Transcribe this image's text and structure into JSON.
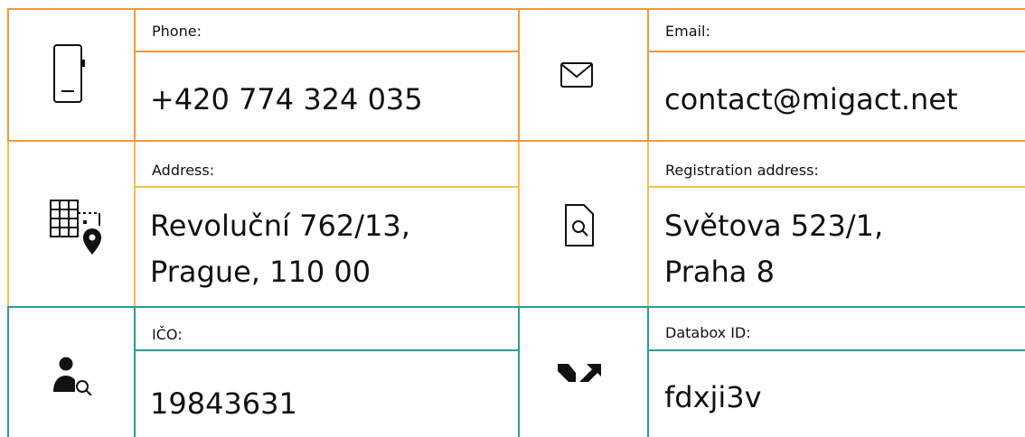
{
  "colors": {
    "row1_border": "#ef9a3d",
    "row2_border": "#f2c14e",
    "row3_border": "#2a9d97",
    "text": "#111111"
  },
  "cards": [
    {
      "id": "phone",
      "icon": "smartphone-icon",
      "label": "Phone:",
      "value_lines": [
        "+420 774 324 035"
      ]
    },
    {
      "id": "email",
      "icon": "envelope-icon",
      "label": "Email:",
      "value_lines": [
        "contact@migact.net"
      ]
    },
    {
      "id": "address",
      "icon": "building-pin-icon",
      "label": "Address:",
      "value_lines": [
        "Revoluční 762/13,",
        "Prague, 110 00"
      ]
    },
    {
      "id": "registration-address",
      "icon": "document-search-icon",
      "label": "Registration address:",
      "value_lines": [
        "Světova 523/1,",
        "Praha 8"
      ]
    },
    {
      "id": "ico",
      "icon": "person-search-icon",
      "label": "IČO:",
      "value_lines": [
        "19843631"
      ]
    },
    {
      "id": "databox",
      "icon": "databox-arrows-icon",
      "label": "Databox ID:",
      "value_lines": [
        "fdxji3v"
      ]
    }
  ]
}
